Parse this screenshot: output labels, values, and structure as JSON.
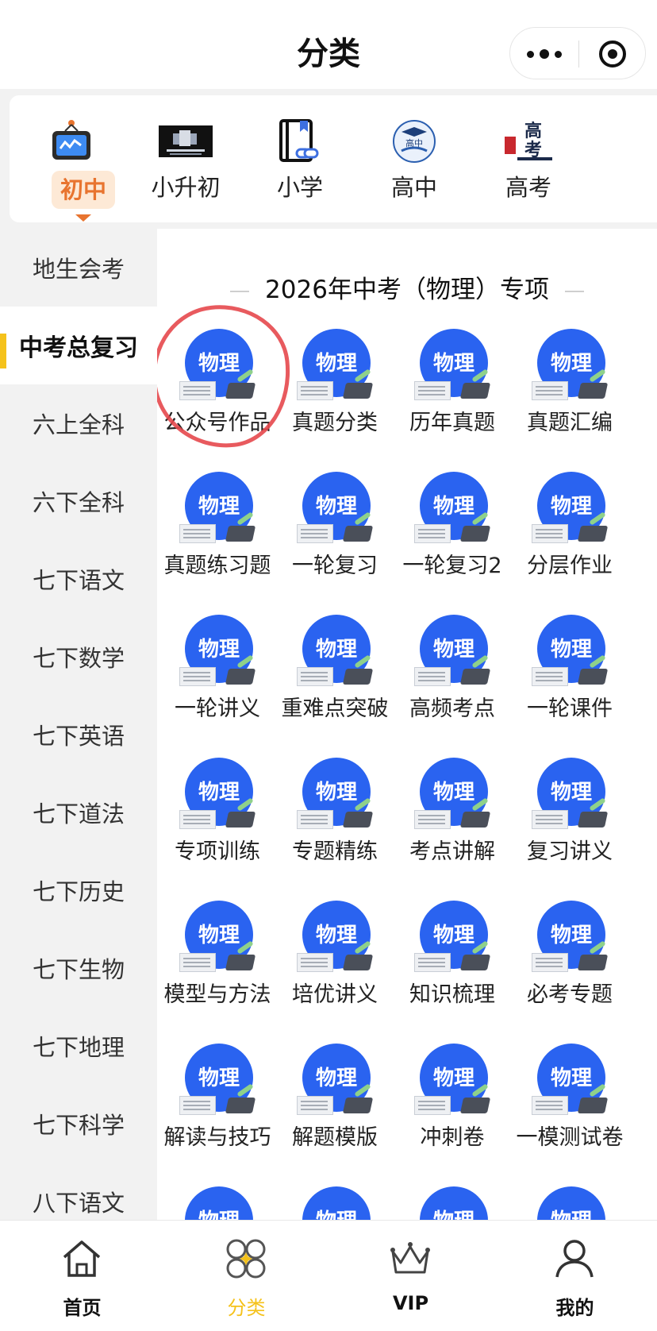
{
  "header": {
    "title": "分类"
  },
  "categories": [
    {
      "label": "初中",
      "icon": "tv-icon",
      "active": true
    },
    {
      "label": "小升初",
      "icon": "banner-icon",
      "active": false
    },
    {
      "label": "小学",
      "icon": "book-link-icon",
      "active": false
    },
    {
      "label": "高中",
      "icon": "graduation-cap-icon",
      "active": false
    },
    {
      "label": "高考",
      "icon": "gaokao-badge-icon",
      "active": false
    }
  ],
  "sidebar": {
    "items": [
      "地生会考",
      "中考总复习",
      "六上全科",
      "六下全科",
      "七下语文",
      "七下数学",
      "七下英语",
      "七下道法",
      "七下历史",
      "七下生物",
      "七下地理",
      "七下科学",
      "八下语文"
    ],
    "active_index": 1
  },
  "main": {
    "section_title": "2026年中考（物理）专项",
    "badge_text": "物理",
    "items": [
      "公众号作品",
      "真题分类",
      "历年真题",
      "真题汇编",
      "真题练习题",
      "一轮复习",
      "一轮复习2",
      "分层作业",
      "一轮讲义",
      "重难点突破",
      "高频考点",
      "一轮课件",
      "专项训练",
      "专题精练",
      "考点讲解",
      "复习讲义",
      "模型与方法",
      "培优讲义",
      "知识梳理",
      "必考专题",
      "解读与技巧",
      "解题模版",
      "冲刺卷",
      "一模测试卷",
      "",
      "",
      "",
      ""
    ],
    "highlighted_index": 0
  },
  "tabbar": {
    "tabs": [
      {
        "label": "首页",
        "icon": "home-icon",
        "active": false
      },
      {
        "label": "分类",
        "icon": "category-icon",
        "active": true
      },
      {
        "label": "VIP",
        "icon": "crown-icon",
        "active": false
      },
      {
        "label": "我的",
        "icon": "user-icon",
        "active": false
      }
    ]
  },
  "colors": {
    "accent": "#f5c21b",
    "orange": "#e8742f",
    "badge_blue": "#2a63f0",
    "highlight_red": "#e5484d"
  }
}
